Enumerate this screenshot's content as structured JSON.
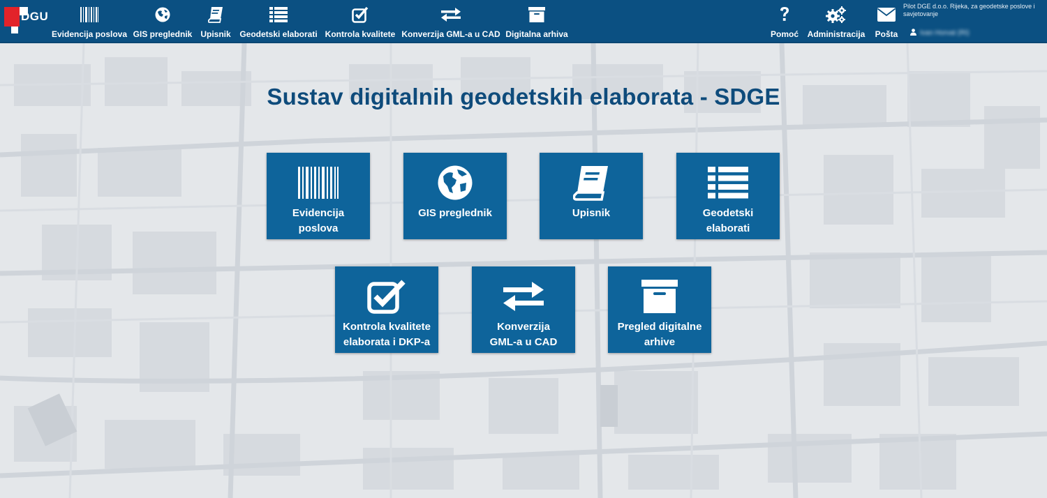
{
  "header": {
    "logo_text": "DGU",
    "nav": [
      {
        "label": "Evidencija poslova",
        "icon": "barcode-icon"
      },
      {
        "label": "GIS preglednik",
        "icon": "globe-icon"
      },
      {
        "label": "Upisnik",
        "icon": "book-icon"
      },
      {
        "label": "Geodetski elaborati",
        "icon": "list-icon"
      },
      {
        "label": "Kontrola kvalitete",
        "icon": "checkbox-icon"
      },
      {
        "label": "Konverzija GML-a u CAD",
        "icon": "exchange-icon"
      },
      {
        "label": "Digitalna arhiva",
        "icon": "archive-icon"
      }
    ],
    "right_nav": [
      {
        "label": "Pomoć",
        "icon": "question-icon"
      },
      {
        "label": "Administracija",
        "icon": "gears-icon"
      },
      {
        "label": "Pošta",
        "icon": "envelope-icon"
      }
    ],
    "company": "Pilot DGE d.o.o. Rijeka, za geodetske poslove i savjetovanje",
    "user_name": "Ivan Horvat (RI)",
    "user_icon": "user-icon"
  },
  "main": {
    "title": "Sustav digitalnih geodetskih elaborata - SDGE",
    "tiles": [
      {
        "label": "Evidencija\nposlova",
        "icon": "barcode-icon"
      },
      {
        "label": "GIS preglednik",
        "icon": "globe-icon"
      },
      {
        "label": "Upisnik",
        "icon": "book-icon"
      },
      {
        "label": "Geodetski\nelaborati",
        "icon": "list-icon"
      },
      {
        "label": "Kontrola kvalitete\nelaborata i DKP-a",
        "icon": "checkbox-icon"
      },
      {
        "label": "Konverzija\nGML-a u CAD",
        "icon": "exchange-icon"
      },
      {
        "label": "Pregled digitalne\narhive",
        "icon": "archive-icon"
      }
    ]
  },
  "colors": {
    "header_bg": "#0b5082",
    "tile_bg": "#0e649b",
    "title_color": "#0e4b7b",
    "map_bg": "#e4e7ea"
  }
}
